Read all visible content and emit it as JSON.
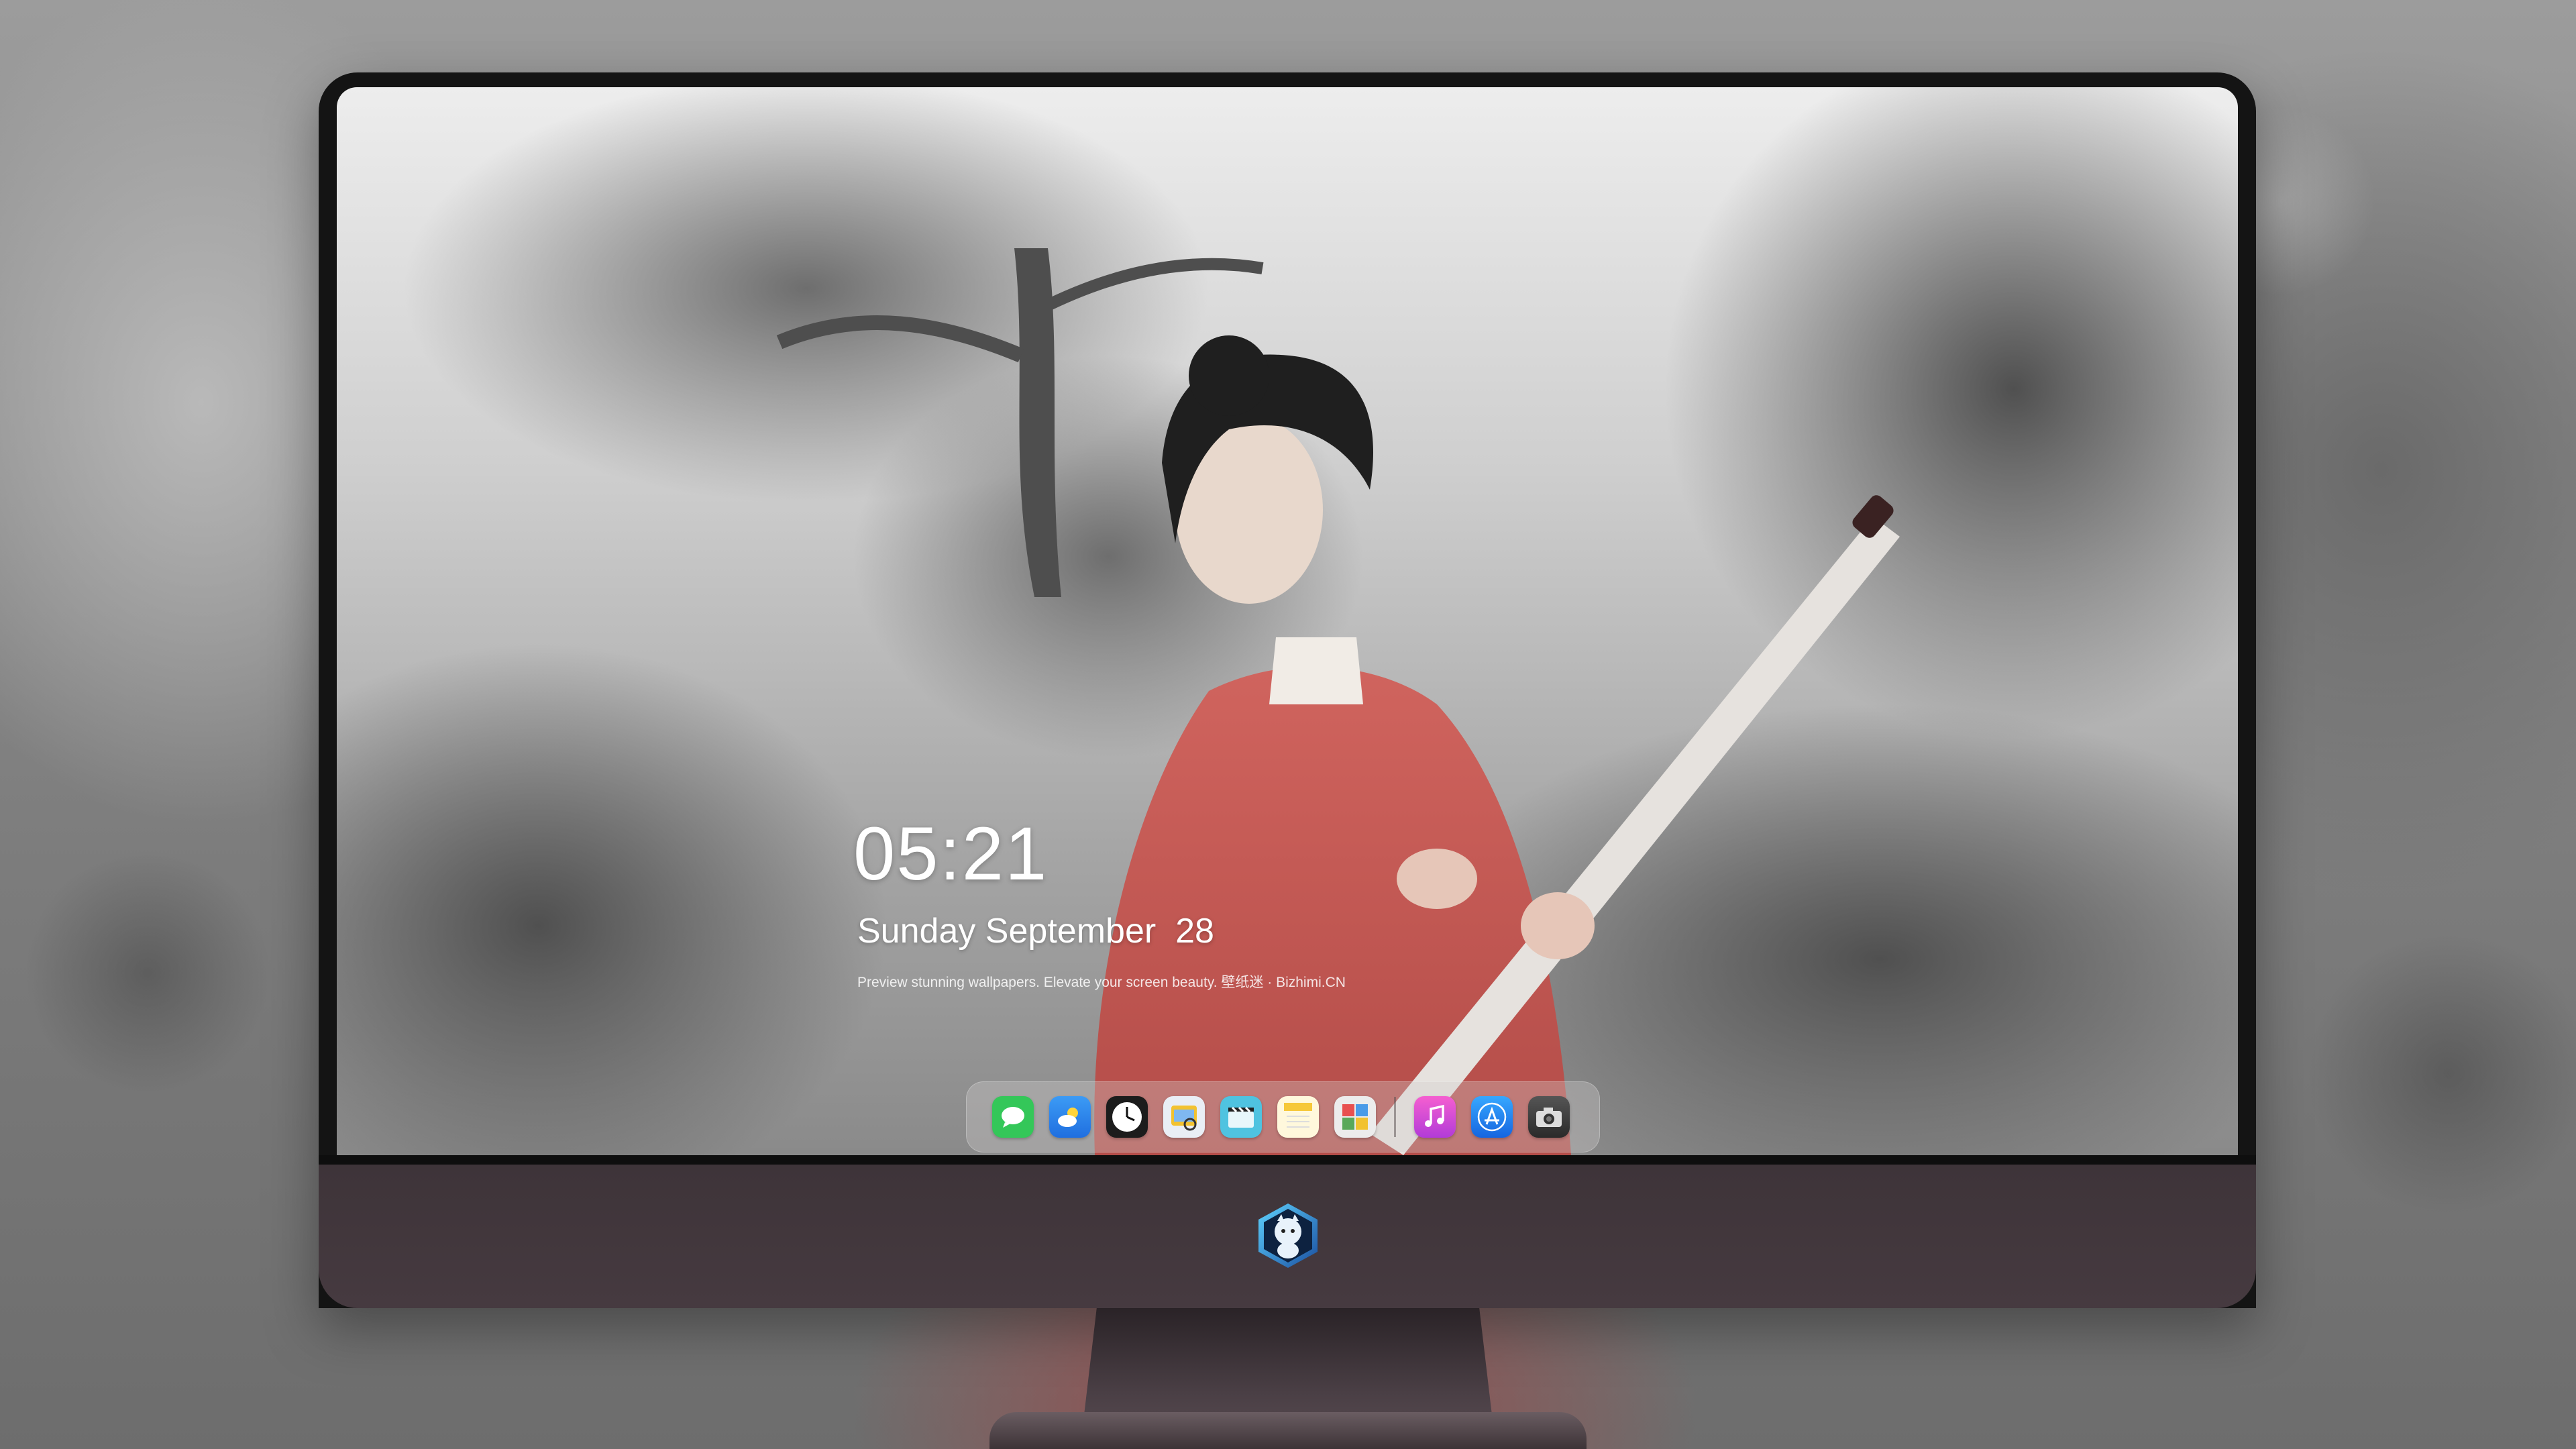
{
  "lockscreen": {
    "time": "05:21",
    "date": "Sunday September  28",
    "tagline": "Preview stunning wallpapers. Elevate your screen beauty. 壁纸迷 · Bizhimi.CN"
  },
  "dock": {
    "apps": [
      {
        "name": "messages-icon",
        "color": "#34c759"
      },
      {
        "name": "weather-icon",
        "color": "#2f8bf1"
      },
      {
        "name": "clock-icon",
        "color": "#1c1c1c"
      },
      {
        "name": "preview-icon",
        "color": "#f2c230"
      },
      {
        "name": "clips-icon",
        "color": "#4fc3e0"
      },
      {
        "name": "notes-icon",
        "color": "#f6d85a"
      },
      {
        "name": "photo-booth-icon",
        "color": "#5aa85a"
      },
      {
        "name": "music-icon",
        "color": "#e24ad9"
      },
      {
        "name": "app-store-icon",
        "color": "#1e88f5"
      },
      {
        "name": "camera-icon",
        "color": "#3a3a3a"
      }
    ]
  },
  "colors": {
    "chin": "#3e3439",
    "bezel": "#141414",
    "robe": "#c85a55"
  }
}
